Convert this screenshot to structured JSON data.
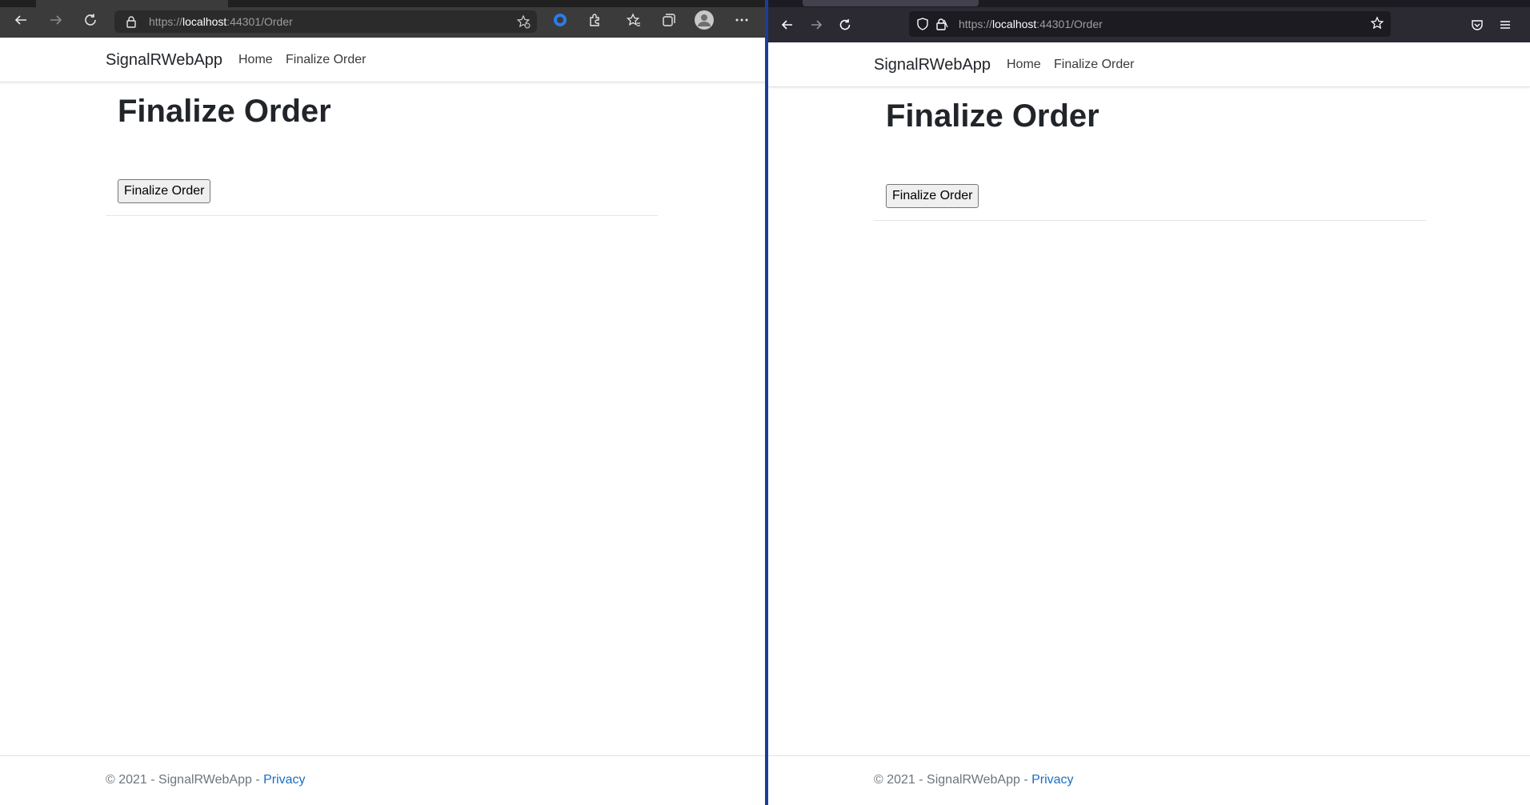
{
  "left_browser": {
    "url_prefix": "https://",
    "url_host": "localhost",
    "url_rest": ":44301/Order",
    "icons": [
      "back-icon",
      "forward-icon",
      "refresh-icon",
      "lock-icon",
      "add-favorite-icon",
      "edge-extension-icon",
      "puzzle-icon",
      "favorites-icon",
      "collections-icon",
      "avatar",
      "more-icon"
    ]
  },
  "right_browser": {
    "url_prefix": "https://",
    "url_host": "localhost",
    "url_rest": ":44301/Order",
    "icons": [
      "back-icon",
      "forward-icon",
      "refresh-icon",
      "shield-icon",
      "lock-icon",
      "star-icon",
      "pocket-icon",
      "menu-icon"
    ]
  },
  "app": {
    "brand": "SignalRWebApp",
    "nav": [
      {
        "label": "Home"
      },
      {
        "label": "Finalize Order"
      }
    ],
    "heading": "Finalize Order",
    "button_label": "Finalize Order",
    "footer_text": "© 2021 - SignalRWebApp - ",
    "footer_link": "Privacy"
  },
  "colors": {
    "accent_border": "#1c3f94",
    "link": "#1b6ec2"
  }
}
